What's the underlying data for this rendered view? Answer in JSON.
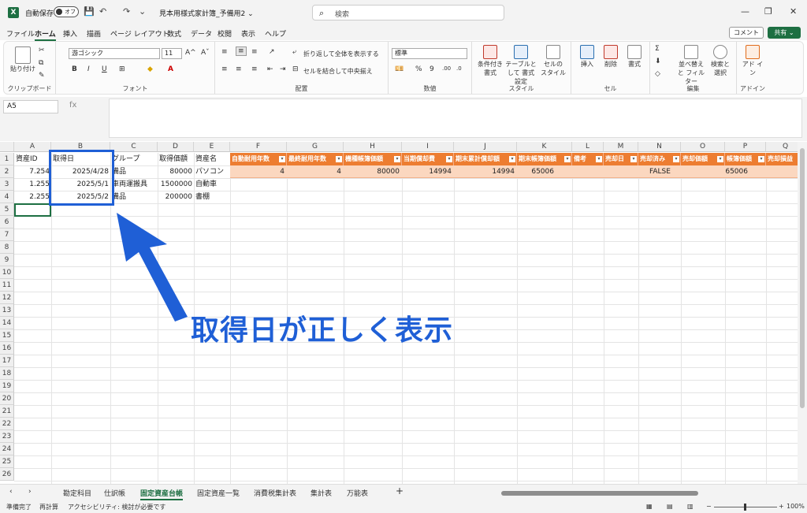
{
  "titlebar": {
    "app_logo": "X",
    "autosave_label": "自動保存",
    "autosave_state": "オフ",
    "doc_title": "見本用様式家計簿_予備用2 ⌄",
    "search_placeholder": "検索",
    "save_icon": "💾",
    "undo_icon": "↶",
    "redo_icon": "↷",
    "more_icon": "⌄",
    "minimize": "—",
    "restore": "❐",
    "close": "✕"
  },
  "menu": {
    "tabs": [
      "ファイル",
      "ホーム",
      "挿入",
      "描画",
      "ページ レイアウト",
      "数式",
      "データ",
      "校閲",
      "表示",
      "ヘルプ"
    ],
    "comment_label": "コメント",
    "share_label": "共有 ⌄"
  },
  "ribbon": {
    "clipboard": {
      "paste": "貼り付け",
      "label": "クリップボード"
    },
    "font": {
      "name": "游ゴシック",
      "size": "11",
      "bold": "B",
      "italic": "I",
      "underline": "U",
      "grow": "A^",
      "shrink": "Aˇ",
      "label": "フォント"
    },
    "align": {
      "wrap": "折り返して全体を表示する",
      "merge": "セルを結合して中央揃え",
      "label": "配置"
    },
    "number": {
      "format": "標準",
      "label": "数値"
    },
    "style": {
      "cond": "条件付き 書式",
      "table": "テーブルとして 書式設定",
      "cell": "セルの スタイル",
      "label": "スタイル"
    },
    "cells": {
      "insert": "挿入",
      "delete": "削除",
      "format": "書式",
      "label": "セル"
    },
    "edit": {
      "sort": "並べ替えと フィルター",
      "find": "検索と 選択",
      "label": "編集"
    },
    "addin": {
      "addin": "アド イン",
      "label": "アドイン"
    }
  },
  "formula_bar": {
    "name_box": "A5",
    "fx": "fx",
    "value": ""
  },
  "columns": [
    "A",
    "B",
    "C",
    "D",
    "E",
    "F",
    "G",
    "H",
    "I",
    "J",
    "K",
    "L",
    "M",
    "N",
    "O",
    "P",
    "Q"
  ],
  "rows": [
    "1",
    "2",
    "3",
    "4",
    "5",
    "6",
    "7",
    "8",
    "9",
    "10",
    "11",
    "12",
    "13",
    "14",
    "15",
    "16",
    "17",
    "18",
    "19",
    "20",
    "21",
    "22",
    "23",
    "24",
    "25",
    "26"
  ],
  "plain_headers": {
    "a": "資産ID",
    "b": "取得日",
    "c": "グループ",
    "d": "取得価額",
    "e": "資産名"
  },
  "orange_headers": [
    "自動耐用年数",
    "最終耐用年数",
    "機種帳簿価額",
    "当期償却費",
    "期末累計償却額",
    "期末帳簿価額",
    "備考",
    "売却日",
    "売却済み",
    "売却価額",
    "帳簿価額",
    "売却損益"
  ],
  "data_rows": [
    {
      "a": "7.254",
      "b": "2025/4/28",
      "c": "備品",
      "d": "80000",
      "e": "パソコン"
    },
    {
      "a": "1.255",
      "b": "2025/5/1",
      "c": "車両運搬具",
      "d": "1500000",
      "e": "自動車"
    },
    {
      "a": "2.255",
      "b": "2025/5/2",
      "c": "備品",
      "d": "200000",
      "e": "書棚"
    }
  ],
  "orange_values": {
    "f": "4",
    "g": "4",
    "h": "80000",
    "i": "14994",
    "j": "14994",
    "k": "65006",
    "n": "FALSE",
    "p": "65006"
  },
  "callout_text": "取得日が正しく表示",
  "sheet_tabs": [
    "勘定科目",
    "仕訳帳",
    "固定資産台帳",
    "固定資産一覧",
    "消費税集計表",
    "集計表",
    "万能表"
  ],
  "add_sheet": "+",
  "status": {
    "ready": "準備完了",
    "recalc": "再計算",
    "accessibility": "アクセシビリティ: 検討が必要です",
    "zoom": "100%"
  },
  "colors": {
    "accent": "#1d6f42",
    "header_orange": "#ed7d31",
    "row_orange": "#fbd7bf",
    "callout_blue": "#1f5fd6"
  }
}
